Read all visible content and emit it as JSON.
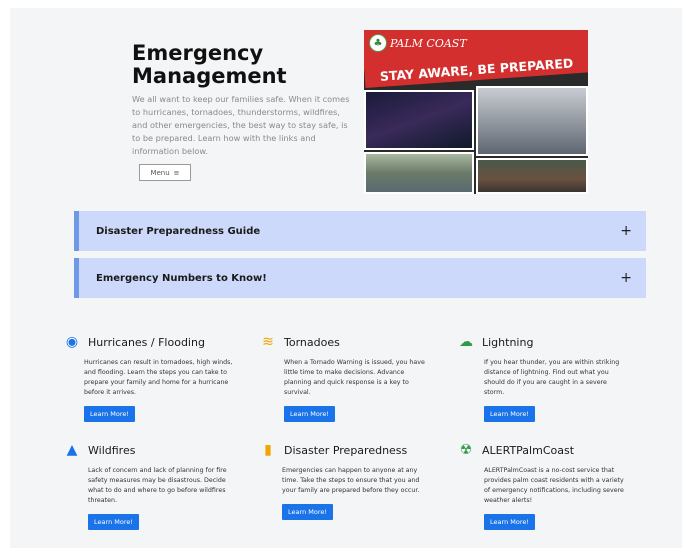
{
  "hero": {
    "title_line1": "Emergency",
    "title_line2": "Management",
    "text": "We all want to keep our families safe. When it comes to hurricanes, tornadoes, thunderstorms, wildfires, and other emergencies, the best way to stay safe, is to be prepared. Learn how with the links and information below.",
    "menu_label": "Menu",
    "menu_icon": "≡"
  },
  "banner": {
    "logo_text": "PALM COAST",
    "slogan": "STAY AWARE, BE PREPARED"
  },
  "accordions": [
    {
      "title": "Disaster Preparedness Guide",
      "toggle": "+"
    },
    {
      "title": "Emergency Numbers to Know!",
      "toggle": "+"
    }
  ],
  "cards": [
    {
      "title": "Hurricanes / Flooding",
      "icon": "hurricane-icon",
      "glyph": "◉",
      "color": "#1a73e8",
      "text": "Hurricanes can result in tornadoes, high winds, and flooding. Learn the steps you can take to prepare your family and home for a hurricane before it arrives.",
      "button": "Learn More!"
    },
    {
      "title": "Tornadoes",
      "icon": "tornado-icon",
      "glyph": "≋",
      "color": "#f0a500",
      "text": "When a Tornado Warning is issued, you have little time to make decisions. Advance planning and quick response is a key to survival.",
      "button": "Learn More!"
    },
    {
      "title": "Lightning",
      "icon": "lightning-cloud-icon",
      "glyph": "☁",
      "color": "#2e9a4a",
      "text": "If you hear thunder, you are within striking distance of lightning. Find out what you should do if you are caught in a severe storm.",
      "button": "Learn More!"
    },
    {
      "title": "Wildfires",
      "icon": "wildfire-icon",
      "glyph": "▲",
      "color": "#1a73e8",
      "text": "Lack of concern and lack of planning for fire safety measures may be disastrous. Decide what to do and where to go before wildfires threaten.",
      "button": "Learn More!"
    },
    {
      "title": "Disaster Preparedness",
      "icon": "clipboard-icon",
      "glyph": "▮",
      "color": "#f0a500",
      "text": "Emergencies can happen to anyone at any time. Take the steps to ensure that you and your family are prepared before they occur.",
      "button": "Learn More!"
    },
    {
      "title": "ALERTPalmCoast",
      "icon": "alert-siren-icon",
      "glyph": "☢",
      "color": "#2e9a4a",
      "text": "ALERTPalmCoast is a no-cost service that provides palm coast residents with a variety of emergency notifications, including severe weather alerts!",
      "button": "Learn More!"
    }
  ]
}
